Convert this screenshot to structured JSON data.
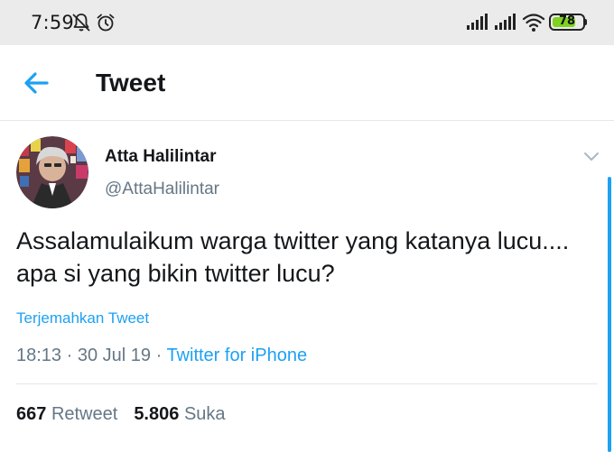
{
  "status_bar": {
    "time": "7:59",
    "battery_level": "78",
    "battery_fraction": 0.78,
    "icons": [
      "bell-muted-icon",
      "alarm-icon",
      "signal-icon",
      "signal-icon",
      "wifi-icon",
      "battery-icon"
    ]
  },
  "header": {
    "title": "Tweet",
    "back_icon": "arrow-left-icon"
  },
  "tweet": {
    "display_name": "Atta Halilintar",
    "handle": "@AttaHalilintar",
    "text": "Assalamulaikum warga twitter yang katanya lucu.... apa si yang bikin twitter lucu?",
    "translate_label": "Terjemahkan Tweet",
    "time": "18:13",
    "date": "30 Jul 19",
    "source": "Twitter for iPhone",
    "separator": " · ",
    "retweet_count": "667",
    "retweet_label": "Retweet",
    "like_count": "5.806",
    "like_label": "Suka"
  },
  "colors": {
    "accent": "#1da1f2",
    "text_primary": "#14171a",
    "text_secondary": "#657786",
    "status_bar_bg": "#ebebeb",
    "battery_fill": "#7ed321"
  }
}
